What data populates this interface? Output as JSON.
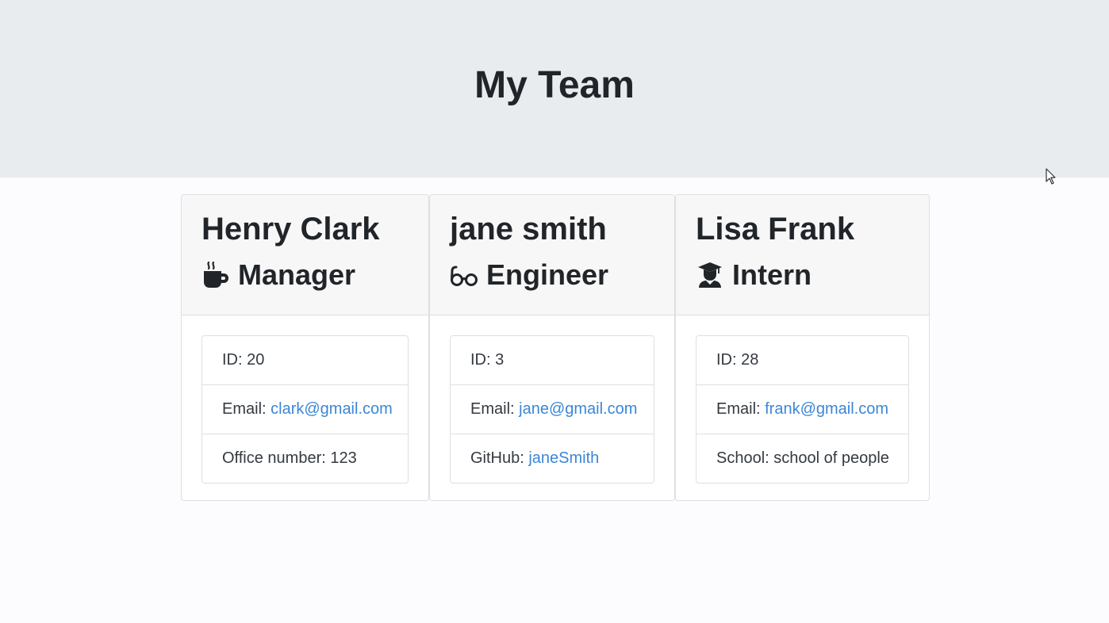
{
  "header": {
    "title": "My Team"
  },
  "team": [
    {
      "name": "Henry Clark",
      "role": "Manager",
      "role_icon": "coffee-icon",
      "id_label": "ID: 20",
      "email_prefix": "Email: ",
      "email": "clark@gmail.com",
      "extra_prefix": "Office number: 123",
      "extra_link": ""
    },
    {
      "name": "jane smith",
      "role": "Engineer",
      "role_icon": "glasses-icon",
      "id_label": "ID: 3",
      "email_prefix": "Email: ",
      "email": "jane@gmail.com",
      "extra_prefix": "GitHub: ",
      "extra_link": "janeSmith"
    },
    {
      "name": "Lisa Frank",
      "role": "Intern",
      "role_icon": "graduate-icon",
      "id_label": "ID: 28",
      "email_prefix": "Email: ",
      "email": "frank@gmail.com",
      "extra_prefix": "School: school of people",
      "extra_link": ""
    }
  ],
  "colors": {
    "link": "#3b86d6",
    "header_bg": "#e9ecef"
  }
}
